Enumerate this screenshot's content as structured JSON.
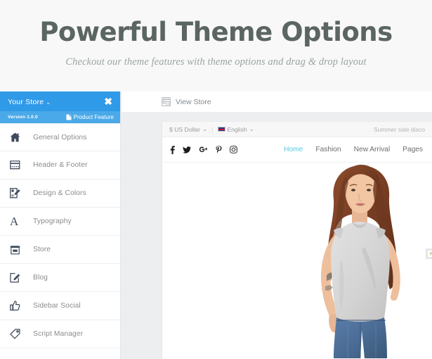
{
  "hero": {
    "title": "Powerful Theme Options",
    "subtitle": "Checkout our theme features with theme options and drag & drop layout"
  },
  "sidebar": {
    "store_name": "Your Store",
    "caret": "⌄",
    "close_icon": "✖",
    "version": "Version 1.0.0",
    "product_feature": "Product Feature",
    "items": [
      {
        "label": "General Options",
        "icon": "home-icon"
      },
      {
        "label": "Header & Footer",
        "icon": "layout-icon"
      },
      {
        "label": "Design & Colors",
        "icon": "palette-icon"
      },
      {
        "label": "Typography",
        "icon": "typography-icon",
        "glyph": "A"
      },
      {
        "label": "Store",
        "icon": "store-icon"
      },
      {
        "label": "Blog",
        "icon": "edit-icon"
      },
      {
        "label": "Sidebar Social",
        "icon": "thumbs-up-icon"
      },
      {
        "label": "Script Manager",
        "icon": "tag-icon"
      }
    ]
  },
  "toolbar": {
    "view_store": "View Store"
  },
  "preview": {
    "topbar": {
      "currency": "$ US Dollar",
      "currency_caret": "⌄",
      "divider": "|",
      "language": "English",
      "language_caret": "⌄",
      "promo": "Summer sale disco"
    },
    "socials": [
      {
        "name": "facebook-icon",
        "glyph": "f"
      },
      {
        "name": "twitter-icon",
        "glyph": "🐦"
      },
      {
        "name": "google-plus-icon",
        "glyph": "G+"
      },
      {
        "name": "pinterest-icon",
        "glyph": "P"
      },
      {
        "name": "instagram-icon",
        "glyph": "▣"
      }
    ],
    "nav": [
      {
        "label": "Home",
        "active": true
      },
      {
        "label": "Fashion",
        "active": false
      },
      {
        "label": "New Arrival",
        "active": false
      },
      {
        "label": "Pages",
        "active": false
      }
    ],
    "hotspot": "+"
  },
  "colors": {
    "accent_blue": "#2f9ae8",
    "accent_blue_light": "#4aa9e8",
    "nav_active": "#56cbe0",
    "title": "#5b6562",
    "subtitle": "#9aa4a2",
    "page_bg": "#f8f8f8",
    "shell_bg": "#eceef0"
  }
}
